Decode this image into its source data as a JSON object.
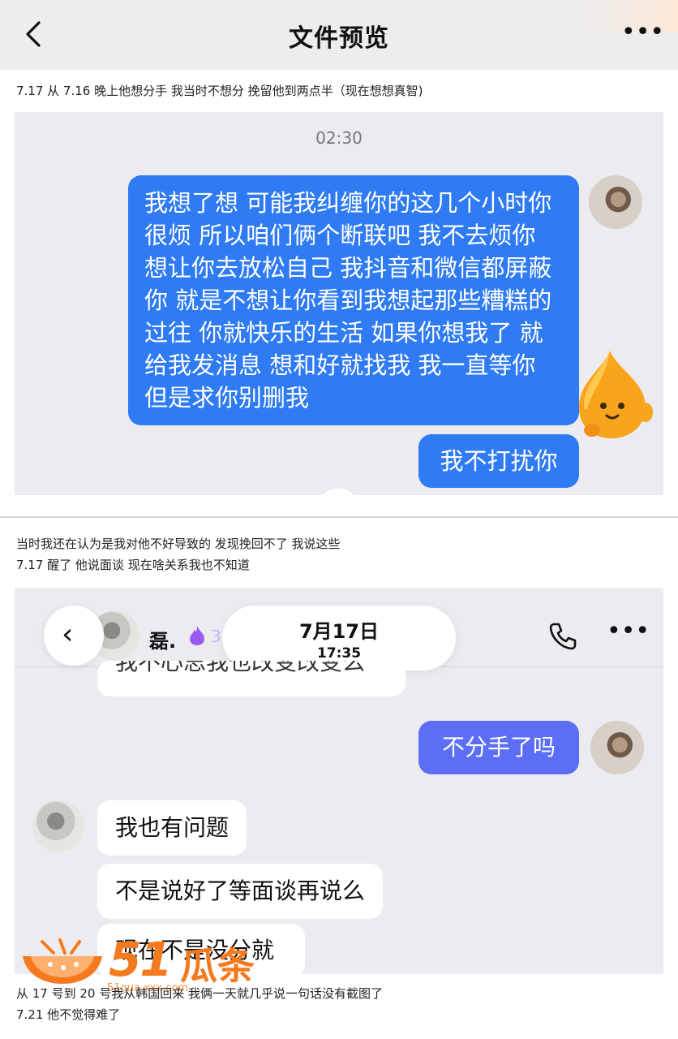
{
  "appbar": {
    "title": "文件预览",
    "more": "•••"
  },
  "notes": {
    "top": "7.17 从 7.16 晚上他想分手 我当时不想分 挽留他到两点半（现在想想真智)",
    "middle_1": "当时我还在认为是我对他不好导致的 发现挽回不了 我说这些",
    "middle_2": "7.17 醒了 他说面谈 现在啥关系我也不知道",
    "bottom_1": "从 17 号到 20 号我从韩国回来 我俩一天就几乎说一句话没有截图了",
    "bottom_2": "7.21 他不觉得难了"
  },
  "panel1": {
    "time": "02:30",
    "long_message": "我想了想 可能我纠缠你的这几个小时你很烦 所以咱们俩个断联吧 我不去烦你 想让你去放松自己 我抖音和微信都屏蔽你 就是不想让你看到我想起那些糟糕的过往 你就快乐的生活 如果你想我了 就给我发消息 想和好就找我 我一直等你 但是求你别删我",
    "short_message": "我不打扰你"
  },
  "panel2": {
    "contact_name": "磊.",
    "streak": "38",
    "date": "7月17日",
    "time": "17:35",
    "more": "•••",
    "cut_message": "我不心思我也改变改变么",
    "sent_message": "不分手了吗",
    "received": [
      "我也有问题",
      "不是说好了等面谈再说么",
      "现在不是没分就"
    ]
  },
  "watermark": {
    "digits": "51",
    "name": "瓜条",
    "url": "51gua.xxx.com"
  },
  "colors": {
    "blue_bubble": "#2f7bf3",
    "purple_bubble": "#5b6ef5",
    "watermark": "#f47a1f",
    "panel_bg": "#ececf0"
  }
}
